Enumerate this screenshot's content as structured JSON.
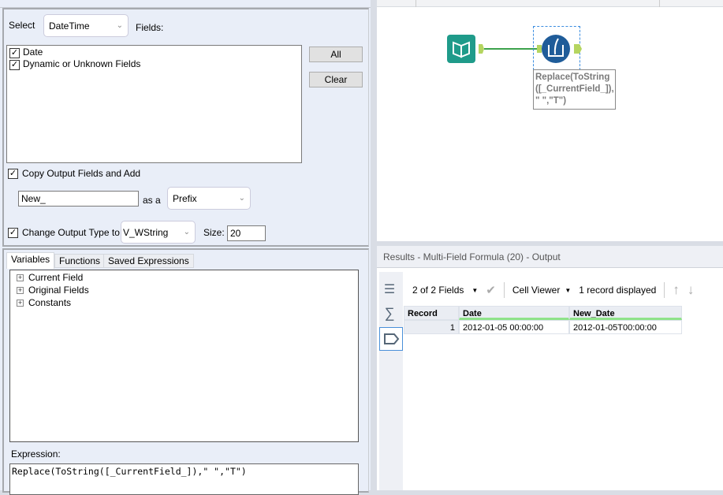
{
  "config": {
    "select_label": "Select",
    "select_value": "DateTime",
    "fields_label": "Fields:",
    "fields": [
      {
        "label": "Date",
        "checked": true
      },
      {
        "label": "Dynamic or Unknown Fields",
        "checked": true
      }
    ],
    "all_button": "All",
    "clear_button": "Clear",
    "copy_output_label": "Copy Output Fields and Add",
    "copy_output_checked": true,
    "prefix_value": "New_",
    "as_a_label": "as a",
    "prefix_mode": "Prefix",
    "change_type_label": "Change Output Type to",
    "change_type_checked": true,
    "type_value": "V_WString",
    "size_label": "Size:",
    "size_value": "20"
  },
  "tabs": [
    "Variables",
    "Functions",
    "Saved Expressions"
  ],
  "tree": [
    "Current Field",
    "Original Fields",
    "Constants"
  ],
  "expression_label": "Expression:",
  "expression": "Replace(ToString([_CurrentField_]),\" \",\"T\")",
  "canvas": {
    "tool_annotation": "Replace(ToString ([_CurrentField_]), \" \",\"T\")"
  },
  "results": {
    "title": "Results - Multi-Field Formula (20) - Output",
    "fields_selector": "2 of 2 Fields",
    "cell_viewer": "Cell Viewer",
    "records_displayed": "1 record displayed",
    "columns": [
      "Record",
      "Date",
      "New_Date"
    ],
    "rows": [
      [
        "1",
        "2012-01-05 00:00:00",
        "2012-01-05T00:00:00"
      ]
    ]
  },
  "colors": {
    "accent_green": "#7ee07a",
    "tool_blue": "#1f5c99",
    "input_teal": "#1f9b8a"
  }
}
